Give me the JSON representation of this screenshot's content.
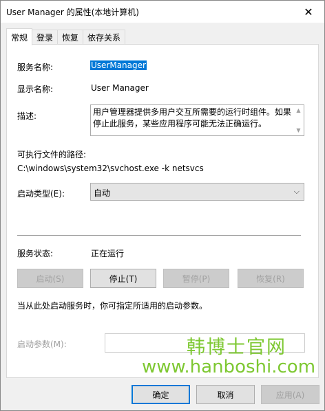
{
  "window": {
    "title": "User Manager 的属性(本地计算机)",
    "close_glyph": "✕"
  },
  "tabs": [
    {
      "label": "常规"
    },
    {
      "label": "登录"
    },
    {
      "label": "恢复"
    },
    {
      "label": "依存关系"
    }
  ],
  "general": {
    "service_name_label": "服务名称:",
    "service_name_value": "UserManager",
    "display_name_label": "显示名称:",
    "display_name_value": "User Manager",
    "description_label": "描述:",
    "description_value": "用户管理器提供多用户交互所需要的运行时组件。如果停止此服务，某些应用程序可能无法正确运行。",
    "exe_path_label": "可执行文件的路径:",
    "exe_path_value": "C:\\windows\\system32\\svchost.exe -k netsvcs",
    "startup_type_label": "启动类型(E):",
    "startup_type_value": "自动",
    "service_status_label": "服务状态:",
    "service_status_value": "正在运行",
    "start_button": "启动(S)",
    "stop_button": "停止(T)",
    "pause_button": "暂停(P)",
    "resume_button": "恢复(R)",
    "hint_text": "当从此处启动服务时，你可指定所适用的启动参数。",
    "start_params_label": "启动参数(M):",
    "start_params_value": ""
  },
  "watermark": {
    "cn": "韩博士官网",
    "url": "www.hanboshi.com"
  },
  "footer": {
    "ok_button": "确定",
    "cancel_button": "取消",
    "apply_button": "应用(A)"
  }
}
